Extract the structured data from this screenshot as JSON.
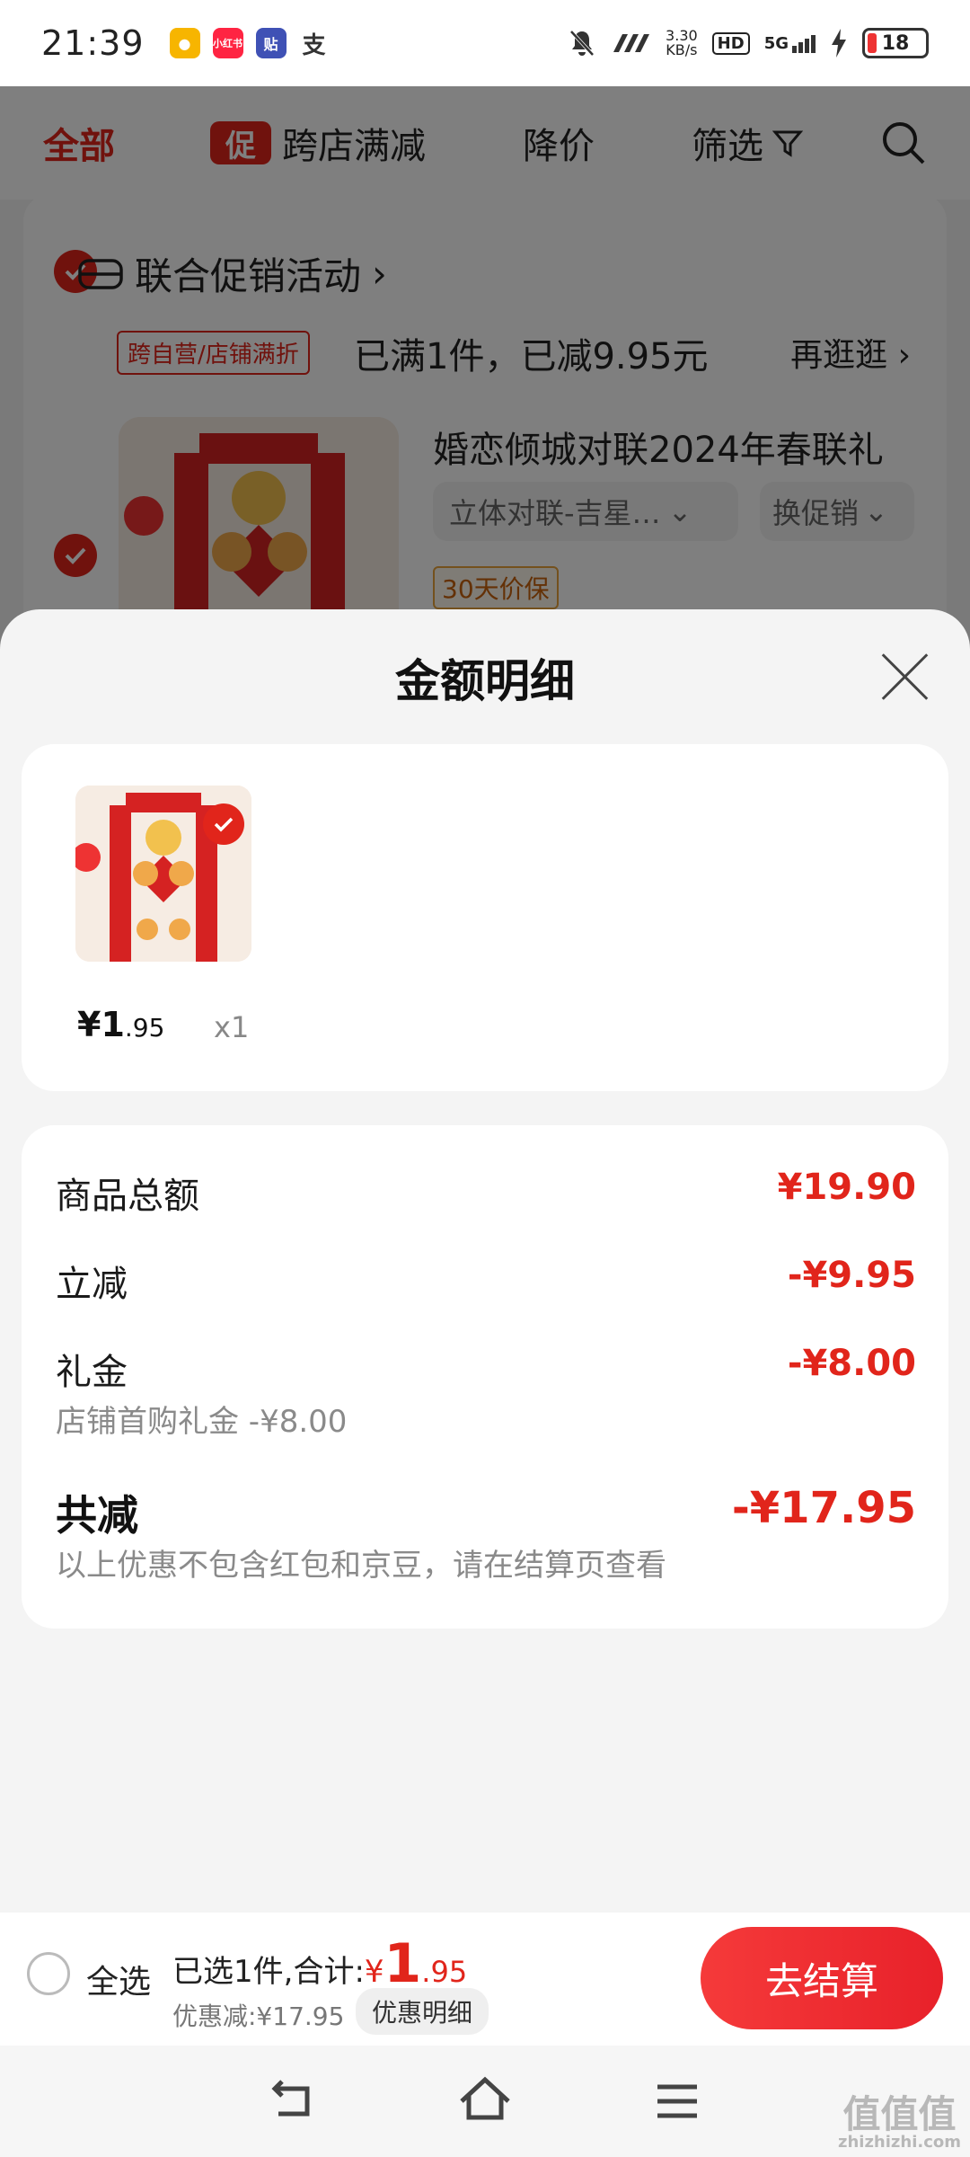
{
  "status_bar": {
    "time": "21:39",
    "app_icons": [
      "app-icon-1",
      "xiaohongshu-icon",
      "tieba-icon",
      "alipay-icon"
    ],
    "net_speed": "3.30",
    "net_unit": "KB/s",
    "hd": "HD",
    "signal": "5G",
    "battery": "18"
  },
  "top_nav": {
    "all": "全部",
    "promo_badge": "促",
    "promo": "跨店满减",
    "price_drop": "降价",
    "filter": "筛选"
  },
  "cart": {
    "promo_title": "联合促销活动",
    "promo_tag": "跨自营/店铺满折",
    "promo_status": "已满1件，已减9.95元",
    "promo_more": "再逛逛",
    "product_title": "婚恋倾城对联2024年春联礼",
    "spec": "立体对联-吉星…",
    "promo_switch": "换促销",
    "guarantee": "30天价保"
  },
  "sheet": {
    "title": "金额明细",
    "item": {
      "price_int": "¥1",
      "price_dec": ".95",
      "qty": "x1"
    },
    "rows": {
      "total_label": "商品总额",
      "total_value": "¥19.90",
      "instant_label": "立减",
      "instant_value": "-¥9.95",
      "gift_label": "礼金",
      "gift_value": "-¥8.00",
      "gift_sub": "店铺首购礼金 -¥8.00",
      "sum_label": "共减",
      "sum_value": "-¥17.95",
      "note": "以上优惠不包含红包和京豆，请在结算页查看"
    }
  },
  "checkout": {
    "select_all": "全选",
    "selected_text": "已选1件,合计:",
    "currency": "¥",
    "amount_int": "1",
    "amount_dec": ".95",
    "saved": "优惠减:¥17.95",
    "detail_btn": "优惠明细",
    "pay_btn": "去结算"
  },
  "watermark": {
    "text": "值值值",
    "sub": "zhizhizhi.com"
  },
  "colors": {
    "accent": "#e1251b",
    "overlay": "rgba(0,0,0,0.5)"
  }
}
